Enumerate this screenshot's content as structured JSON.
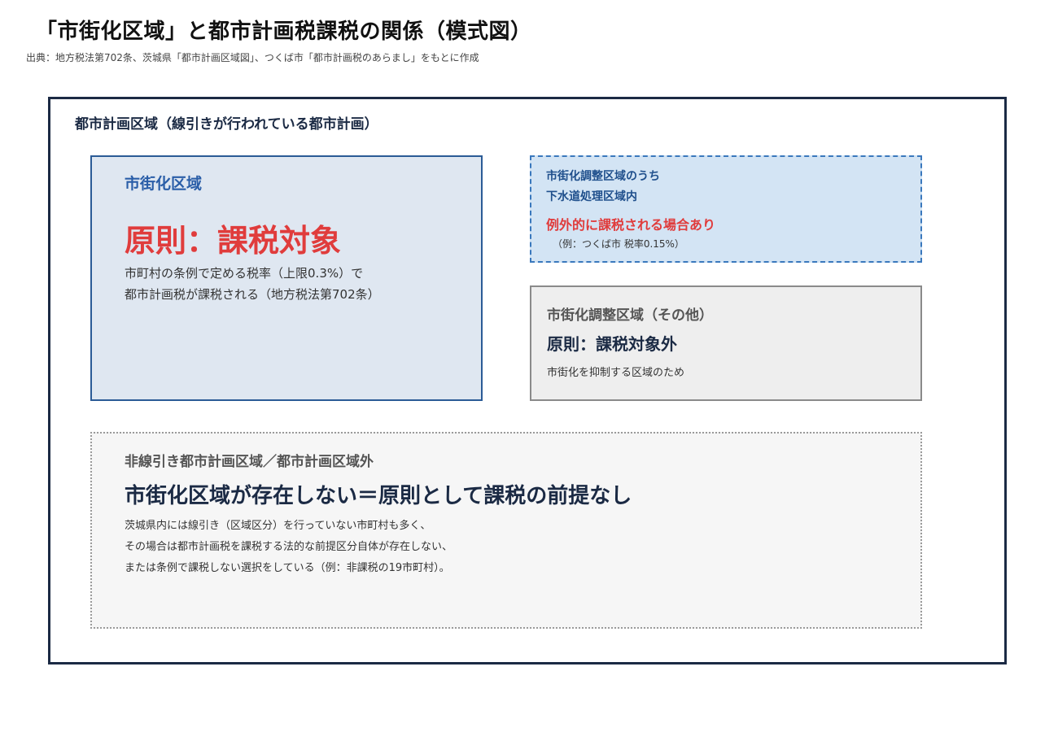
{
  "title": "「市街化区域」と都市計画税課税の関係（模式図）",
  "source": "出典：地方税法第702条、茨城県「都市計画区域図」、つくば市「都市計画税のあらまし」をもとに作成",
  "outer": {
    "label": "都市計画区域（線引きが行われている都市計画）"
  },
  "urban": {
    "label": "市街化区域",
    "main": "原則：課税対象",
    "desc": [
      "市町村の条例で定める税率（上限0.3%）で",
      "都市計画税が課税される（地方税法第702条）"
    ]
  },
  "exception": {
    "label_lines": [
      "市街化調整区域のうち",
      "下水道処理区域内"
    ],
    "main": "例外的に課税される場合あり",
    "note": "（例：つくば市 税率0.15%）"
  },
  "control": {
    "label": "市街化調整区域（その他）",
    "main": "原則：課税対象外",
    "desc": "市街化を抑制する区域のため"
  },
  "nonline": {
    "label": "非線引き都市計画区域／都市計画区域外",
    "main": "市街化区域が存在しない＝原則として課税の前提なし",
    "desc": [
      "茨城県内には線引き（区域区分）を行っていない市町村も多く、",
      "その場合は都市計画税を課税する法的な前提区分自体が存在しない、",
      "または条例で課税しない選択をしている（例：非課税の19市町村）。"
    ]
  },
  "colors": {
    "urban_fill": "#dfe7f1",
    "urban_border": "#2b5b96",
    "exception_fill": "#d3e4f4",
    "exception_border": "#3a78bd",
    "control_fill": "#eeeeee",
    "nonline_fill": "#f6f6f6",
    "accent_red": "#e03c3c",
    "navy": "#1b2a44"
  }
}
